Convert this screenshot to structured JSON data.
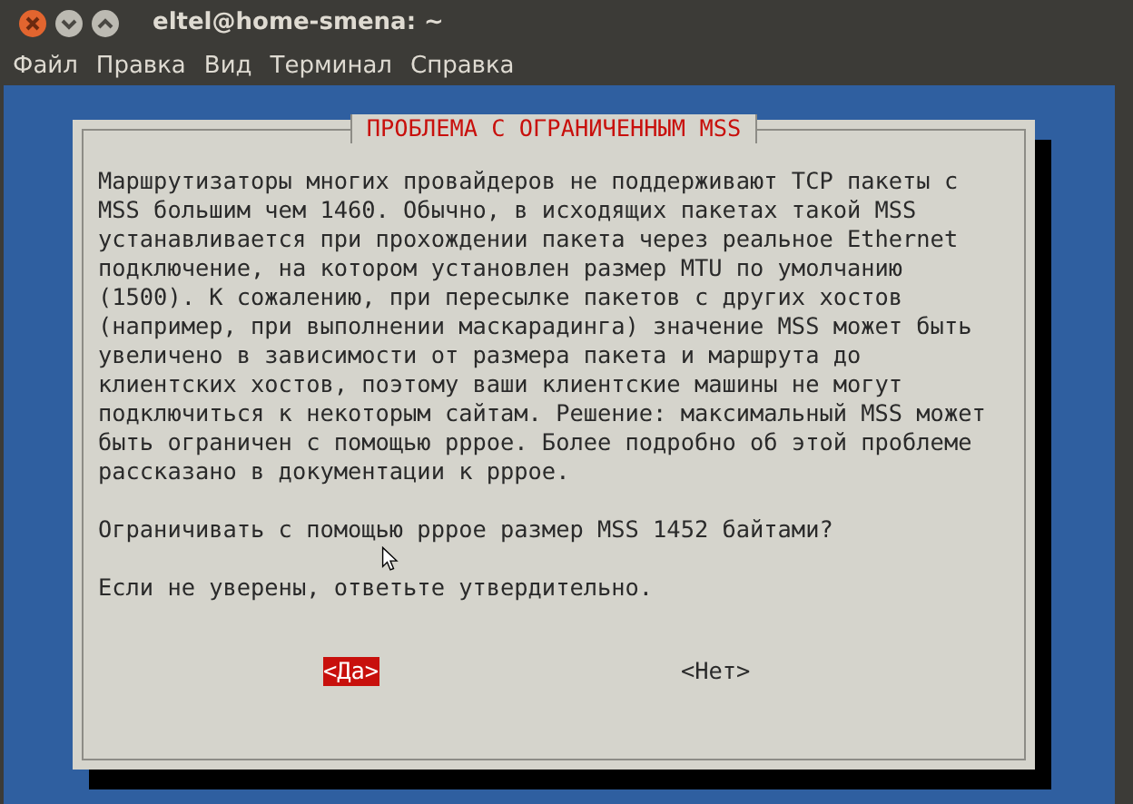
{
  "window": {
    "title": "eltel@home-smena: ~"
  },
  "menu": [
    "Файл",
    "Правка",
    "Вид",
    "Терминал",
    "Справка"
  ],
  "dialog": {
    "title": "ПРОБЛЕМА С ОГРАНИЧЕННЫМ MSS",
    "message": "Маршрутизаторы многих провайдеров не поддерживают TCP пакеты с\nMSS большим чем 1460. Обычно, в исходящих пакетах такой MSS\nустанавливается при прохождении пакета через реальное Ethernet\nподключение, на котором установлен размер MTU по умолчанию\n(1500). К сожалению, при пересылке пакетов с других хостов\n(например, при выполнении маскарадинга) значение MSS может быть\nувеличено в зависимости от размера пакета и маршрута до\nклиентских хостов, поэтому ваши клиентские машины не могут\nподключиться к некоторым сайтам. Решение: максимальный MSS может\nбыть ограничен с помощью pppoe. Более подробно об этой проблеме\nрассказано в документации к pppoe.",
    "question": "Ограничивать с помощью pppoe размер MSS 1452 байтами?",
    "hint": "Если не уверены, ответьте утвердительно.",
    "buttons": [
      {
        "label": "<Да>",
        "selected": true
      },
      {
        "label": "<Нет>",
        "selected": false
      }
    ]
  }
}
